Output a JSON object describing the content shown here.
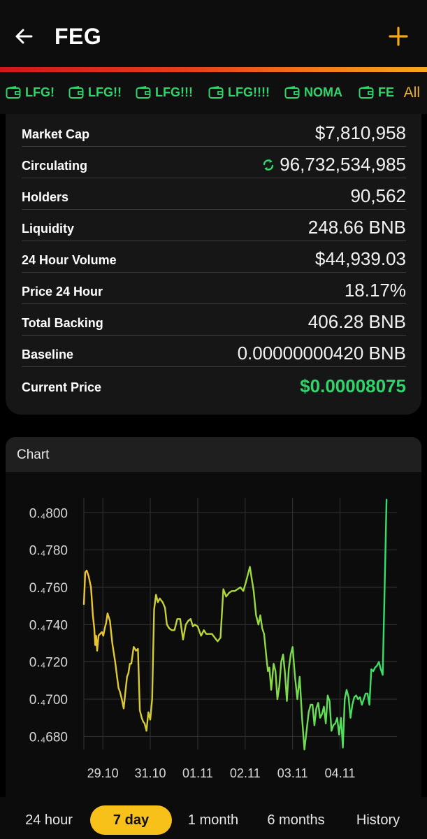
{
  "header": {
    "title": "FEG",
    "back_icon": "arrow-left-icon",
    "add_icon": "plus-icon",
    "accent_color": "#f6a81b"
  },
  "tabs": {
    "items": [
      {
        "label": "LFG!",
        "icon": "wallet-icon"
      },
      {
        "label": "LFG!!",
        "icon": "wallet-icon"
      },
      {
        "label": "LFG!!!",
        "icon": "wallet-icon"
      },
      {
        "label": "LFG!!!!",
        "icon": "wallet-icon"
      },
      {
        "label": "NOMA",
        "icon": "wallet-icon"
      },
      {
        "label": "FE",
        "icon": "wallet-icon"
      }
    ],
    "all_label": "All",
    "tab_color": "#2fd46b"
  },
  "stats": {
    "market_cap": {
      "label": "Market Cap",
      "value": "$7,810,958"
    },
    "circulating": {
      "label": "Circulating",
      "value": "96,732,534,985",
      "icon": "refresh-icon"
    },
    "holders": {
      "label": "Holders",
      "value": "90,562"
    },
    "liquidity": {
      "label": "Liquidity",
      "value": "248.66 BNB"
    },
    "volume_24h": {
      "label": "24 Hour Volume",
      "value": "$44,939.03"
    },
    "price_24h": {
      "label": "Price 24 Hour",
      "value": "18.17%"
    },
    "total_backing": {
      "label": "Total Backing",
      "value": "406.28 BNB"
    },
    "baseline": {
      "label": "Baseline",
      "value": "0.00000000420 BNB"
    },
    "current_price": {
      "label": "Current Price",
      "value": "$0.00008075",
      "color": "#2fd46b"
    }
  },
  "chart": {
    "title": "Chart",
    "y_ticks": [
      "0.₄800",
      "0.₄780",
      "0.₄760",
      "0.₄740",
      "0.₄720",
      "0.₄700",
      "0.₄680"
    ],
    "x_ticks": [
      "29.10",
      "31.10",
      "01.11",
      "02.11",
      "03.11",
      "04.11"
    ]
  },
  "chart_data": {
    "type": "line",
    "title": "",
    "xlabel": "",
    "ylabel": "",
    "y_unit_note": "values in units of 0.0000x (subscript 4 notation)",
    "ylim": [
      0.4673,
      0.4808
    ],
    "x_range_days": [
      0,
      6.6
    ],
    "grid": true,
    "legend": "none",
    "color_gradient": [
      "#f0c430",
      "#a8d83a",
      "#2fe06a"
    ],
    "x": [
      0.0,
      0.03,
      0.06,
      0.1,
      0.15,
      0.19,
      0.22,
      0.24,
      0.26,
      0.28,
      0.31,
      0.34,
      0.38,
      0.41,
      0.44,
      0.47,
      0.5,
      0.55,
      0.6,
      0.66,
      0.7,
      0.73,
      0.76,
      0.8,
      0.84,
      0.88,
      0.91,
      0.94,
      0.97,
      1.0,
      1.05,
      1.1,
      1.14,
      1.18,
      1.22,
      1.25,
      1.28,
      1.32,
      1.36,
      1.4,
      1.44,
      1.48,
      1.52,
      1.56,
      1.6,
      1.66,
      1.71,
      1.75,
      1.8,
      1.85,
      1.91,
      1.97,
      2.03,
      2.09,
      2.15,
      2.2,
      2.25,
      2.3,
      2.34,
      2.4,
      2.47,
      2.53,
      2.58,
      2.64,
      2.7,
      2.76,
      2.82,
      2.88,
      2.94,
      3.0,
      3.06,
      3.12,
      3.18,
      3.24,
      3.3,
      3.36,
      3.42,
      3.47,
      3.5,
      3.53,
      3.58,
      3.63,
      3.68,
      3.72,
      3.76,
      3.8,
      3.85,
      3.88,
      3.91,
      3.95,
      4.0,
      4.04,
      4.08,
      4.12,
      4.16,
      4.2,
      4.24,
      4.28,
      4.32,
      4.36,
      4.4,
      4.45,
      4.5,
      4.55,
      4.6,
      4.65,
      4.7,
      4.74,
      4.78,
      4.82,
      4.86,
      4.9,
      4.94,
      4.98,
      5.02,
      5.06,
      5.1,
      5.14,
      5.18,
      5.22,
      5.26,
      5.3,
      5.34,
      5.38,
      5.42,
      5.46,
      5.5,
      5.54,
      5.58,
      5.62,
      5.66,
      5.7,
      5.74,
      5.78,
      5.82,
      5.86,
      5.9,
      5.94,
      5.98,
      6.02,
      6.06,
      6.1,
      6.14,
      6.18,
      6.22,
      6.26,
      6.3,
      6.34,
      6.38,
      6.42,
      6.46,
      6.5,
      6.55
    ],
    "y": [
      0.4751,
      0.4768,
      0.4769,
      0.4766,
      0.476,
      0.4745,
      0.4738,
      0.4729,
      0.4734,
      0.4726,
      0.4734,
      0.4735,
      0.4736,
      0.4734,
      0.4738,
      0.4741,
      0.4746,
      0.4742,
      0.473,
      0.472,
      0.4712,
      0.4706,
      0.4704,
      0.47,
      0.4695,
      0.4705,
      0.4712,
      0.4714,
      0.4719,
      0.4719,
      0.4728,
      0.4726,
      0.4727,
      0.4694,
      0.469,
      0.4688,
      0.4687,
      0.4683,
      0.4693,
      0.4689,
      0.47,
      0.4748,
      0.4756,
      0.4752,
      0.4754,
      0.4752,
      0.4749,
      0.474,
      0.4738,
      0.4737,
      0.4737,
      0.4743,
      0.4743,
      0.4732,
      0.474,
      0.4742,
      0.4743,
      0.4739,
      0.474,
      0.4739,
      0.4734,
      0.4737,
      0.4735,
      0.4735,
      0.4735,
      0.4733,
      0.4731,
      0.4733,
      0.4759,
      0.4755,
      0.4757,
      0.4758,
      0.4758,
      0.4759,
      0.476,
      0.4758,
      0.4763,
      0.4768,
      0.4771,
      0.4766,
      0.4758,
      0.4745,
      0.474,
      0.4745,
      0.4738,
      0.4735,
      0.4722,
      0.4715,
      0.4717,
      0.4705,
      0.4719,
      0.4715,
      0.47,
      0.4707,
      0.472,
      0.4724,
      0.4714,
      0.4699,
      0.4716,
      0.4724,
      0.4728,
      0.4712,
      0.47,
      0.4712,
      0.469,
      0.4673,
      0.4684,
      0.4693,
      0.4697,
      0.4697,
      0.4686,
      0.4695,
      0.4698,
      0.469,
      0.4692,
      0.4696,
      0.4687,
      0.4702,
      0.4699,
      0.4683,
      0.4686,
      0.4687,
      0.469,
      0.4681,
      0.469,
      0.4674,
      0.47,
      0.4705,
      0.4701,
      0.469,
      0.4697,
      0.4701,
      0.4702,
      0.47,
      0.4701,
      0.4697,
      0.47,
      0.4703,
      0.4703,
      0.4697,
      0.4716,
      0.4715,
      0.4717,
      0.4718,
      0.472,
      0.4716,
      0.4713,
      0.476,
      0.4807
    ]
  },
  "range_tabs": {
    "items": [
      "24 hour",
      "7 day",
      "1 month",
      "6 months",
      "History"
    ],
    "active": "7 day",
    "active_color": "#f7c11a"
  }
}
